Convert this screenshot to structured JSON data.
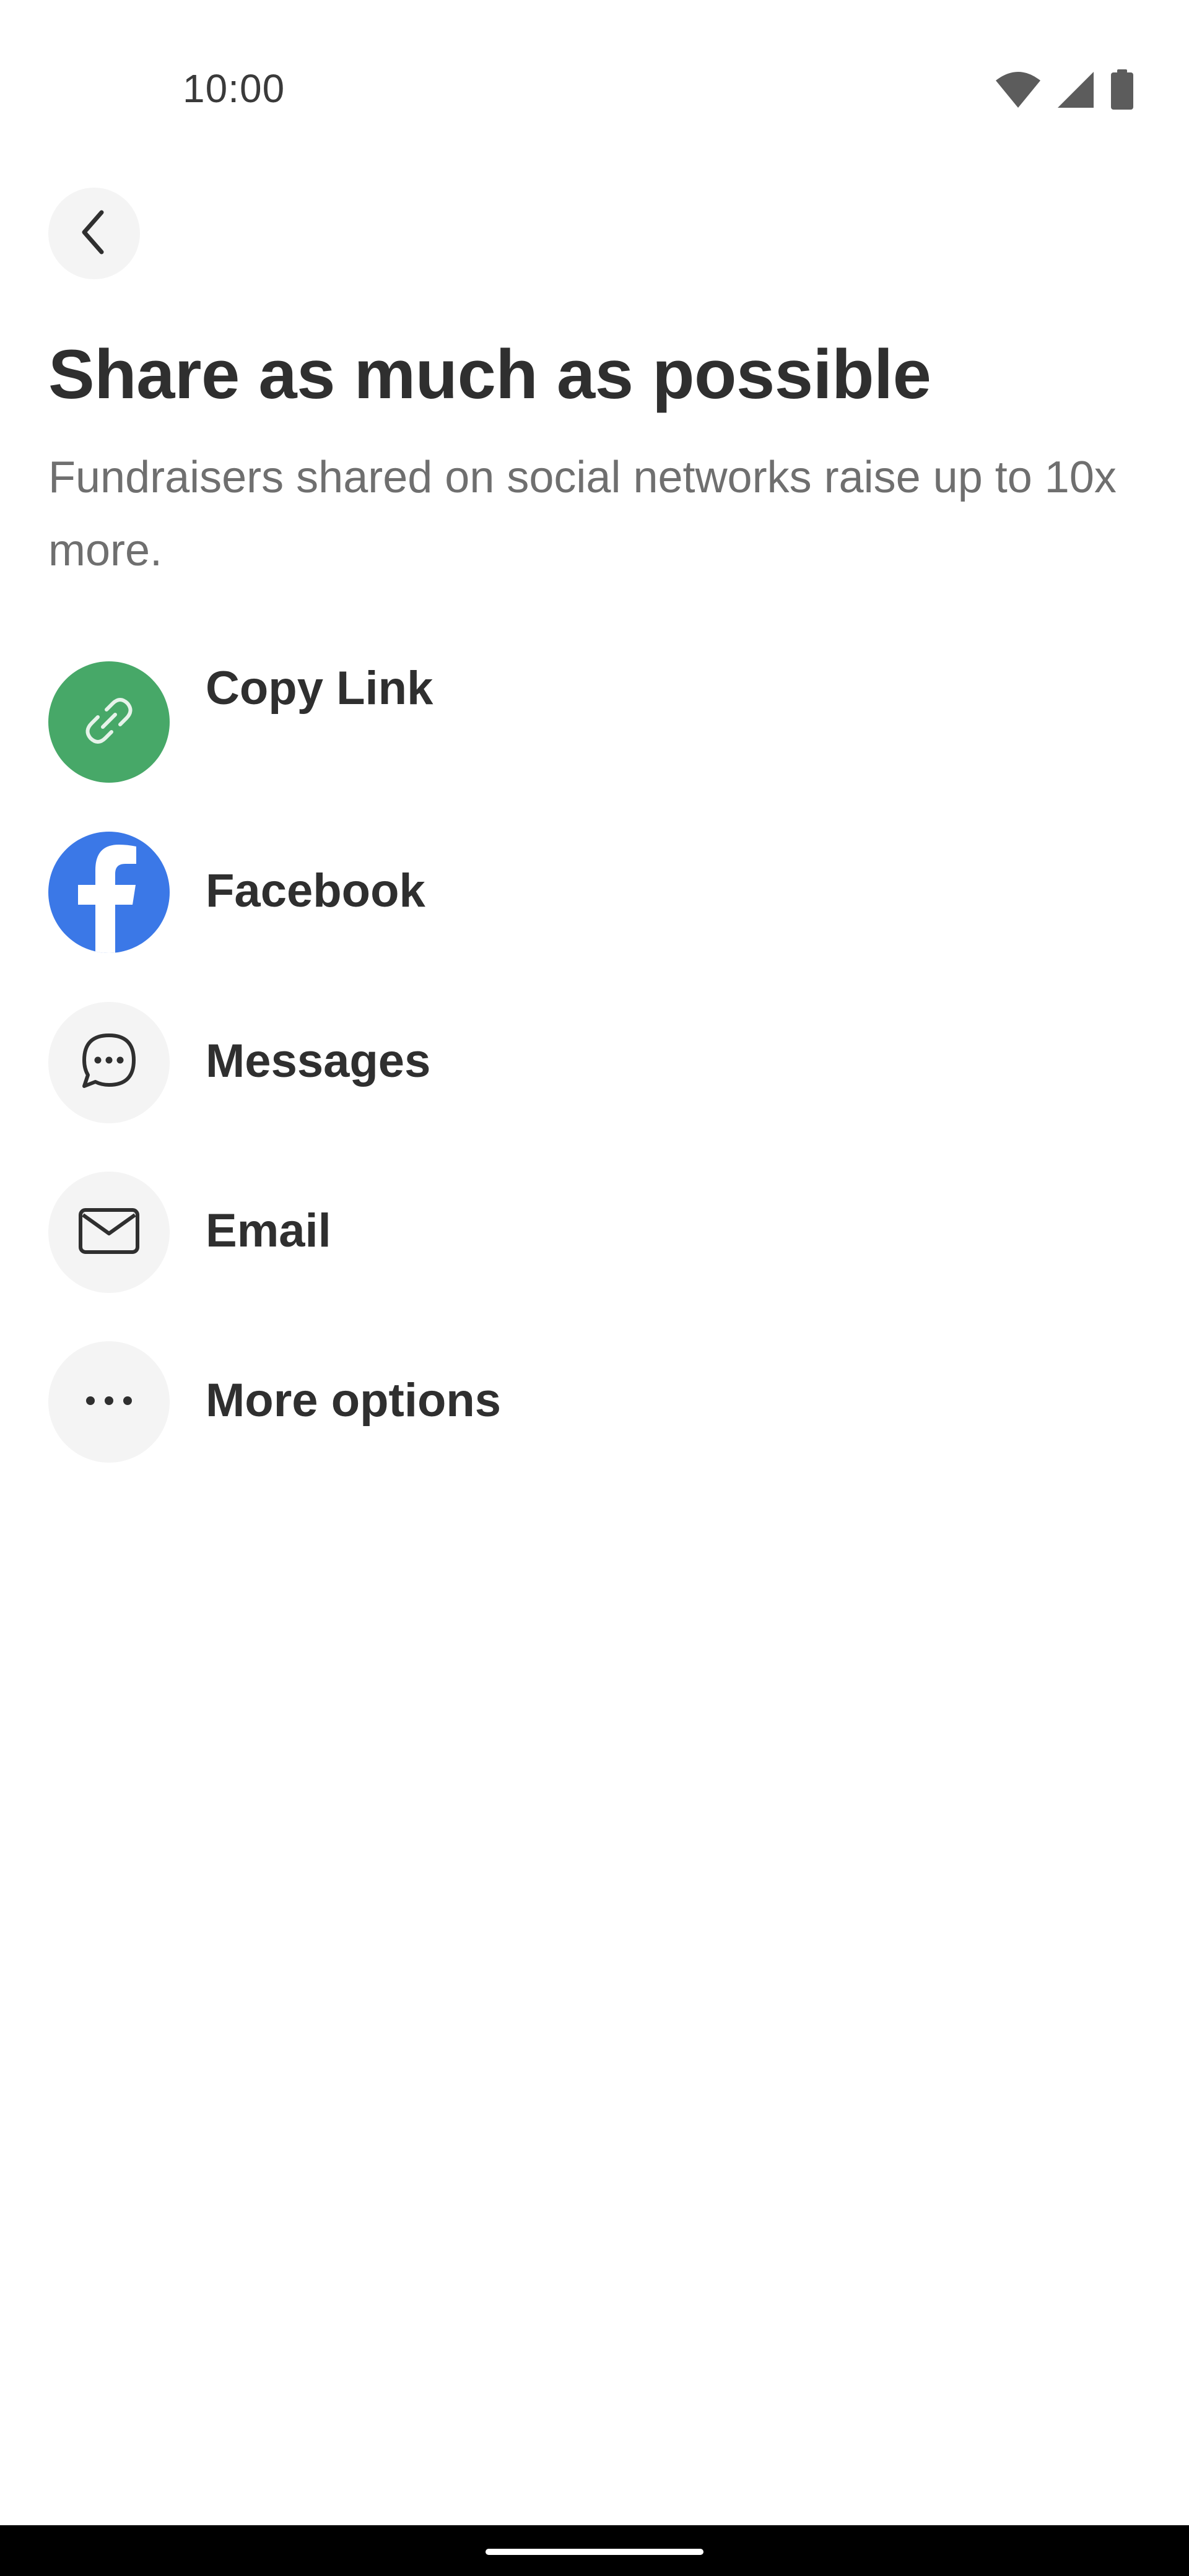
{
  "status_bar": {
    "time": "10:00",
    "icons": [
      "wifi-icon",
      "signal-icon",
      "battery-icon"
    ]
  },
  "header": {
    "back_icon": "chevron-left-icon",
    "title": "Share as much as possible",
    "subtitle": "Fundraisers shared on social networks raise up to 10x more."
  },
  "share_options": [
    {
      "label": "Copy Link",
      "icon": "link-icon",
      "icon_bg": "#47A868"
    },
    {
      "label": "Facebook",
      "icon": "facebook-icon",
      "icon_bg": "#3B78E7"
    },
    {
      "label": "Messages",
      "icon": "message-bubble-icon",
      "icon_bg": "#F4F4F4"
    },
    {
      "label": "Email",
      "icon": "envelope-icon",
      "icon_bg": "#F4F4F4"
    },
    {
      "label": "More options",
      "icon": "more-horizontal-icon",
      "icon_bg": "#F4F4F4"
    }
  ],
  "colors": {
    "title_text": "#2F2F2F",
    "subtitle_text": "#6F6F6F",
    "copy_link_green": "#47A868",
    "facebook_blue": "#3B78E7",
    "neutral_circle": "#F4F4F4"
  }
}
